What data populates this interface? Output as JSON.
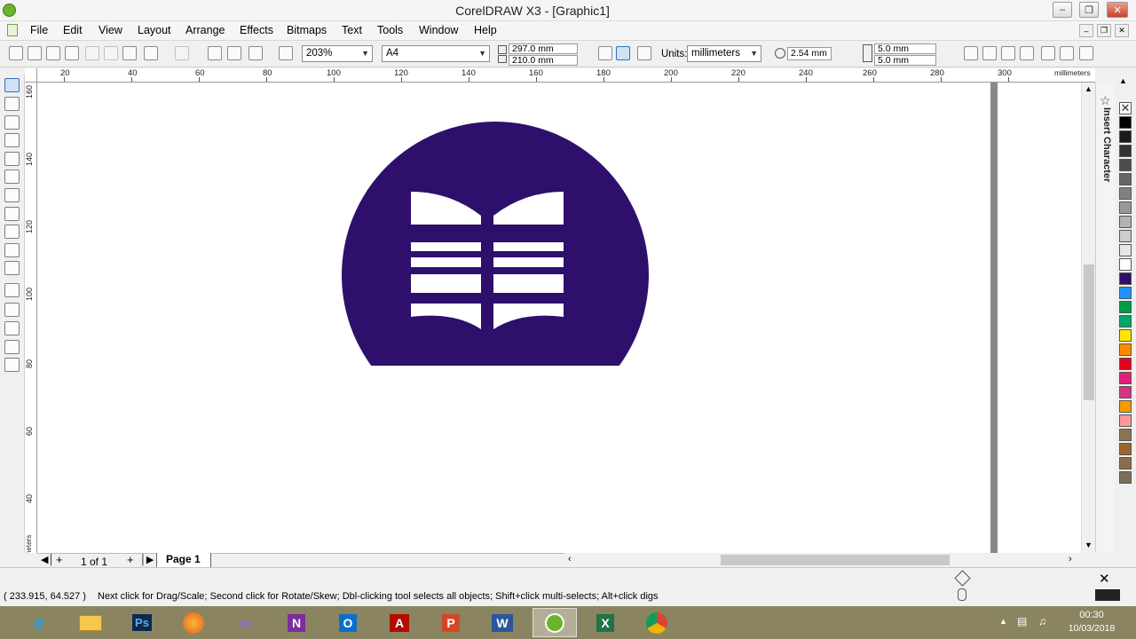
{
  "app_title": "CorelDRAW X3 - [Graphic1]",
  "menu": [
    "File",
    "Edit",
    "View",
    "Layout",
    "Arrange",
    "Effects",
    "Bitmaps",
    "Text",
    "Tools",
    "Window",
    "Help"
  ],
  "toolbar": {
    "zoom": "203%",
    "paper": "A4",
    "width": "297.0 mm",
    "height": "210.0 mm",
    "units_label": "Units:",
    "units": "millimeters",
    "nudge": "2.54 mm",
    "dup_x": "5.0 mm",
    "dup_y": "5.0 mm"
  },
  "ruler_top": {
    "labels": [
      "20",
      "40",
      "60",
      "80",
      "100",
      "120",
      "140",
      "160",
      "180",
      "200",
      "220",
      "240",
      "260",
      "280",
      "300"
    ],
    "unit": "millimeters"
  },
  "ruler_left": {
    "labels": [
      "160",
      "140",
      "120",
      "100",
      "80",
      "60",
      "40"
    ],
    "unit": "millimeters"
  },
  "page_nav": {
    "count": "1 of 1",
    "page_tab": "Page 1"
  },
  "docker_label": "Insert Character",
  "palette": [
    "#000000",
    "#1a1a1a",
    "#333333",
    "#4d4d4d",
    "#666666",
    "#808080",
    "#999999",
    "#b3b3b3",
    "#cccccc",
    "#e6e6e6",
    "#ffffff",
    "#2e0f6b",
    "#1e90ff",
    "#009b48",
    "#00a86b",
    "#ffe600",
    "#ff8c00",
    "#e8001c",
    "#e0207a",
    "#d63384",
    "#ff9900",
    "#ff9999",
    "#8b7355",
    "#996633",
    "#8a6d4b",
    "#7a6f5a"
  ],
  "status": {
    "coords": "( 233.915, 64.527 )",
    "message": "Next click for Drag/Scale; Second click for Rotate/Skew; Dbl-clicking tool selects all objects; Shift+click multi-selects; Alt+click digs"
  },
  "clock": {
    "time": "00:30",
    "date": "10/03/2018"
  },
  "taskbar_apps": [
    "Internet Explorer",
    "File Explorer",
    "Photoshop",
    "Firefox",
    "Visual Studio",
    "OneNote",
    "Outlook",
    "Acrobat",
    "PowerPoint",
    "Word",
    "CorelDRAW",
    "Excel",
    "Chrome"
  ],
  "logo_color": "#2e0f6b"
}
